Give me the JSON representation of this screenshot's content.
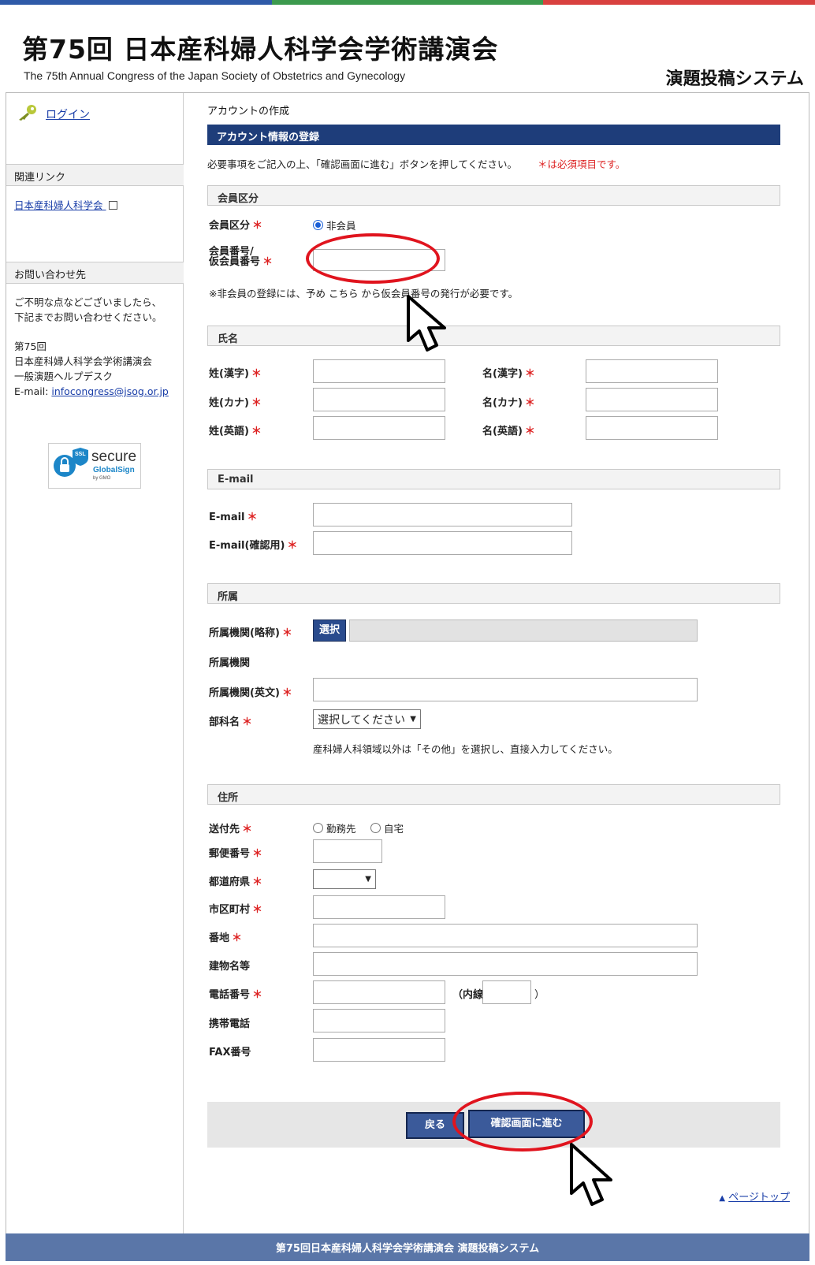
{
  "header": {
    "title": "第75回 日本産科婦人科学会学術講演会",
    "subtitle": "The 75th Annual Congress of the Japan Society of Obstetrics and Gynecology",
    "system_name": "演題投稿システム"
  },
  "colors": {
    "bar1": "#2f5aa8",
    "bar2": "#3c9a4e",
    "bar3": "#d9413f",
    "accent": "#1e3d7a",
    "required": "#d22222",
    "highlight": "#e0141e"
  },
  "sidebar": {
    "login": "ログイン",
    "related_title": "関連リンク",
    "related_link": "日本産科婦人科学会",
    "contact_title": "お問い合わせ先",
    "contact_text1": "ご不明な点などございましたら、",
    "contact_text2": "下記までお問い合わせください。",
    "contact_org1": "第75回",
    "contact_org2": "日本産科婦人科学会学術講演会",
    "contact_org3": "一般演題ヘルプデスク",
    "email_label": "E-mail: ",
    "email": "infocongress@jsog.or.jp",
    "ssl_big": "secure",
    "ssl_brand": "GlobalSign",
    "ssl_by": "by GMO",
    "ssl_tag": "SSL"
  },
  "main": {
    "breadcrumb": "アカウントの作成",
    "section_title": "アカウント情報の登録",
    "intro": "必要事項をご記入の上、「確認画面に進む」ボタンを押してください。",
    "intro_req": "＊は必須項目です。",
    "member": {
      "heading": "会員区分",
      "type_label": "会員区分",
      "type_option": "非会員",
      "number_label1": "会員番号/",
      "number_label2": "仮会員番号",
      "note": "※非会員の登録には、予め こちら から仮会員番号の発行が必要です。"
    },
    "name": {
      "heading": "氏名",
      "last_kanji": "姓(漢字)",
      "first_kanji": "名(漢字)",
      "last_kana": "姓(カナ)",
      "first_kana": "名(カナ)",
      "last_en": "姓(英語)",
      "first_en": "名(英語)"
    },
    "email": {
      "heading": "E-mail",
      "email_label": "E-mail",
      "confirm_label": "E-mail(確認用)"
    },
    "affiliation": {
      "heading": "所属",
      "short_label": "所属機関(略称)",
      "select_button": "選択",
      "org_label": "所属機関",
      "org_en_label": "所属機関(英文)",
      "dept_label": "部科名",
      "dept_value": "選択してください",
      "dept_note": "産科婦人科領域以外は「その他」を選択し、直接入力してください。"
    },
    "address": {
      "heading": "住所",
      "send_label": "送付先",
      "send_opt1": "勤務先",
      "send_opt2": "自宅",
      "postal_label": "郵便番号",
      "pref_label": "都道府県",
      "city_label": "市区町村",
      "street_label": "番地",
      "building_label": "建物名等",
      "phone_label": "電話番号",
      "ext_label": "（内線",
      "ext_close": "）",
      "mobile_label": "携帯電話",
      "fax_label": "FAX番号"
    },
    "back_button": "戻る",
    "next_button": "確認画面に進む",
    "page_top": "ページトップ",
    "star": "＊"
  },
  "footer": "第75回日本産科婦人科学会学術講演会 演題投稿システム"
}
